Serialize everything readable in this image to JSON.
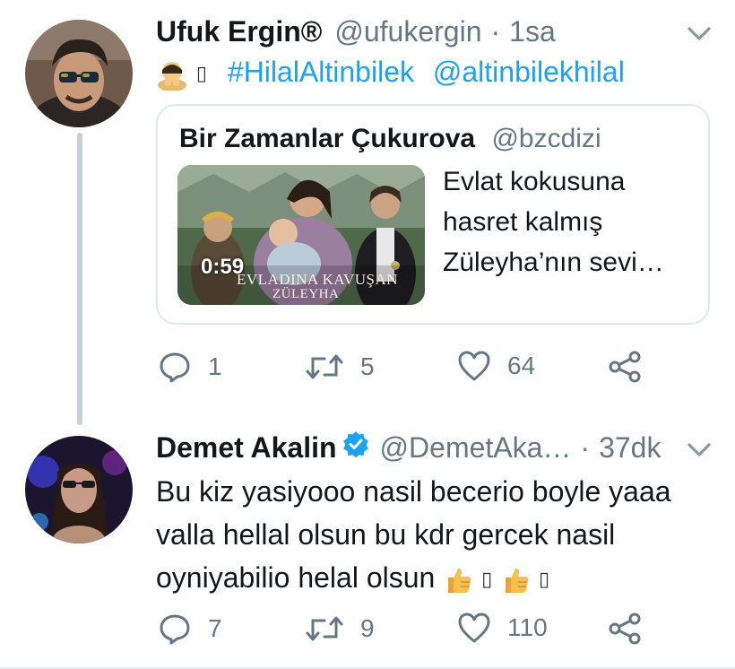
{
  "tweet1": {
    "name": "Ufuk Ergin®",
    "handle": "@ufukergin",
    "separator": "·",
    "time": "1sa",
    "missing_glyph": "▯",
    "hashtag": "#HilalAltinbilek",
    "mention": "@altinbilekhilal",
    "quote": {
      "name": "Bir Zamanlar Çukurova",
      "handle": "@bzcdizi",
      "text": "Evlat kokusuna hasret kalmış Züleyha’nın sevi…",
      "video_duration": "0:59",
      "caption_line1": "EVLADINA KAVUŞAN",
      "caption_line2": "ZÜLEYHA"
    },
    "actions": {
      "replies": "1",
      "retweets": "5",
      "likes": "64"
    }
  },
  "tweet2": {
    "name": "Demet Akalin",
    "handle": "@DemetAka…",
    "separator": "·",
    "time": "37dk",
    "text_line1": "Bu kiz yasiyooo nasil becerio boyle yaaa",
    "text_line2": "valla hellal olsun bu kdr gercek nasil",
    "text_line3": "oyniyabilio helal olsun",
    "missing_glyph": "▯",
    "actions": {
      "replies": "7",
      "retweets": "9",
      "likes": "110"
    }
  },
  "icons": {
    "reply": "reply-icon",
    "retweet": "retweet-icon",
    "like": "heart-icon",
    "share": "share-icon",
    "more": "chevron-down-icon",
    "verified": "verified-badge-icon"
  },
  "colors": {
    "link": "#1da1f2",
    "secondary_text": "#657786",
    "thread_line": "#c4cfd6",
    "card_border": "#e1e8ed"
  }
}
